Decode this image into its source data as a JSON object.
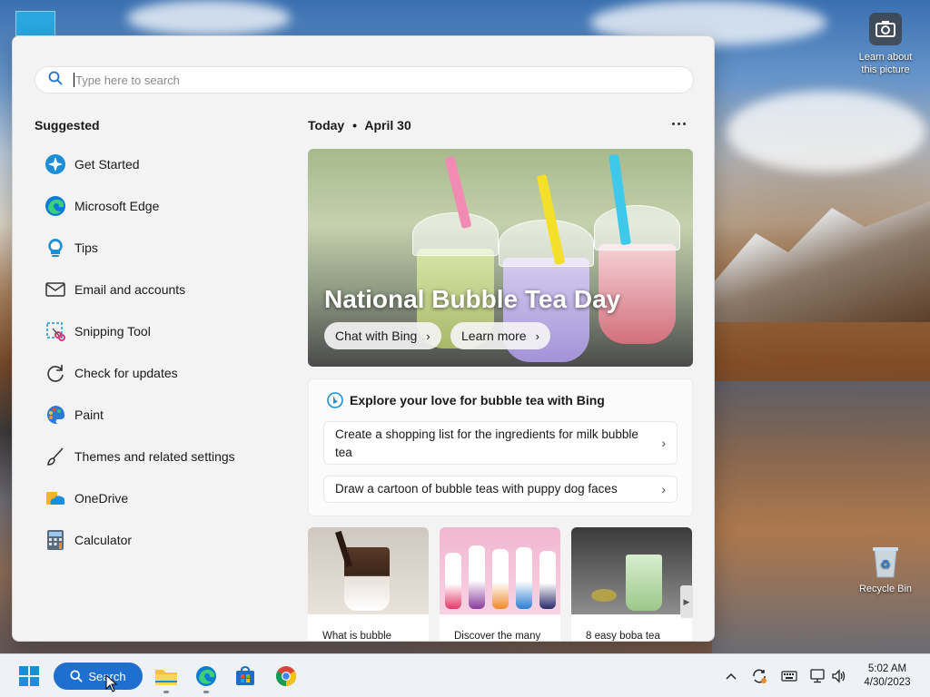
{
  "search": {
    "placeholder": "Type here to search"
  },
  "suggested": {
    "title": "Suggested",
    "items": [
      {
        "label": "Get Started",
        "icon": "get-started-icon"
      },
      {
        "label": "Microsoft Edge",
        "icon": "edge-icon"
      },
      {
        "label": "Tips",
        "icon": "tips-icon"
      },
      {
        "label": "Email and accounts",
        "icon": "mail-icon"
      },
      {
        "label": "Snipping Tool",
        "icon": "snipping-tool-icon"
      },
      {
        "label": "Check for updates",
        "icon": "refresh-icon"
      },
      {
        "label": "Paint",
        "icon": "paint-icon"
      },
      {
        "label": "Themes and related settings",
        "icon": "brush-icon"
      },
      {
        "label": "OneDrive",
        "icon": "onedrive-icon"
      },
      {
        "label": "Calculator",
        "icon": "calculator-icon"
      }
    ]
  },
  "today": {
    "label": "Today",
    "separator": "•",
    "date": "April 30",
    "hero": {
      "title": "National Bubble Tea Day",
      "chat_button": "Chat with Bing",
      "learn_button": "Learn more"
    },
    "bing_card": {
      "heading": "Explore your love for bubble tea with Bing",
      "prompts": [
        "Create a shopping list for the ingredients for milk bubble tea",
        "Draw a cartoon of bubble teas with puppy dog faces"
      ]
    },
    "cards": [
      {
        "caption": "What is bubble"
      },
      {
        "caption": "Discover the many"
      },
      {
        "caption": "8 easy boba tea"
      }
    ]
  },
  "desktop": {
    "learn_picture": "Learn about this picture",
    "recycle_bin": "Recycle Bin"
  },
  "taskbar": {
    "search_label": "Search",
    "time": "5:02 AM",
    "date": "4/30/2023"
  },
  "colors": {
    "accent": "#1f6fd0",
    "panel_bg": "#f3f3f3"
  }
}
